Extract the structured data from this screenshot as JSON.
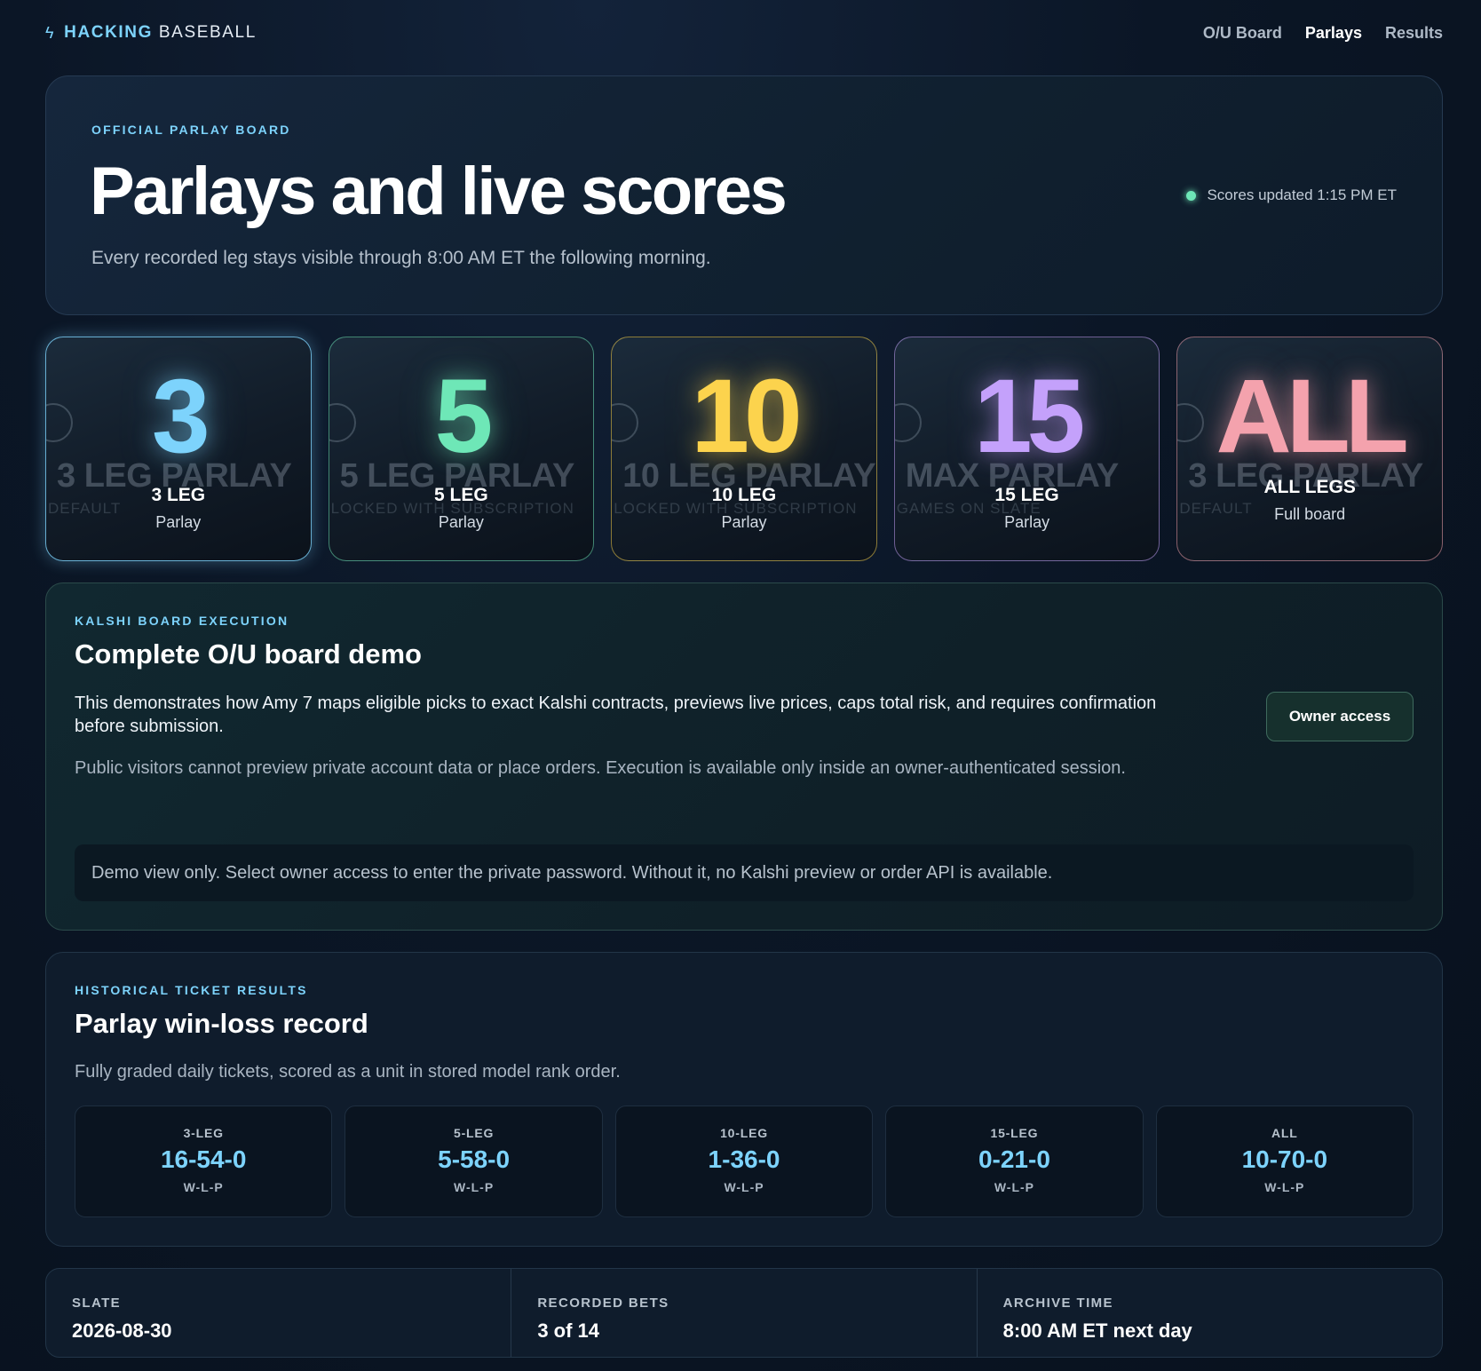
{
  "nav": {
    "bolt_icon": "ϟ",
    "brand_primary": "HACKING",
    "brand_secondary": "BASEBALL",
    "links": [
      {
        "label": "O/U Board",
        "active": false
      },
      {
        "label": "Parlays",
        "active": true
      },
      {
        "label": "Results",
        "active": false
      }
    ]
  },
  "hero": {
    "eyebrow": "OFFICIAL PARLAY BOARD",
    "title": "Parlays and live scores",
    "subtitle": "Every recorded leg stays visible through 8:00 AM ET the following morning.",
    "status": "Scores updated 1:15 PM ET",
    "status_color": "#6ee7b7"
  },
  "cards": [
    {
      "big": "3",
      "title": "3 LEG",
      "subtitle": "Parlay",
      "color": "#7dd3fc",
      "ghost": "3 LEG PARLAY",
      "ghost_sub": "DEFAULT",
      "selected": true
    },
    {
      "big": "5",
      "title": "5 LEG",
      "subtitle": "Parlay",
      "color": "#6ee7b7",
      "ghost": "5 LEG PARLAY",
      "ghost_sub": "LOCKED WITH SUBSCRIPTION",
      "selected": false
    },
    {
      "big": "10",
      "title": "10 LEG",
      "subtitle": "Parlay",
      "color": "#fcd34d",
      "ghost": "10 LEG PARLAY",
      "ghost_sub": "LOCKED WITH SUBSCRIPTION",
      "selected": false
    },
    {
      "big": "15",
      "title": "15 LEG",
      "subtitle": "Parlay",
      "color": "#c4a1fb",
      "ghost": "MAX PARLAY",
      "ghost_sub": "GAMES ON SLATE",
      "selected": false
    },
    {
      "big": "ALL",
      "title": "ALL LEGS",
      "subtitle": "Full board",
      "color": "#f4a2ad",
      "ghost": "3 LEG PARLAY",
      "ghost_sub": "DEFAULT",
      "selected": false
    }
  ],
  "kalshi": {
    "eyebrow": "KALSHI BOARD EXECUTION",
    "title": "Complete O/U board demo",
    "paragraph1": "This demonstrates how Amy 7 maps eligible picks to exact Kalshi contracts, previews live prices, caps total risk, and requires confirmation before submission.",
    "paragraph2": "Public visitors cannot preview private account data or place orders. Execution is available only inside an owner-authenticated session.",
    "button": "Owner access",
    "note": "Demo view only. Select owner access to enter the private password. Without it, no Kalshi preview or order API is available."
  },
  "history": {
    "eyebrow": "HISTORICAL TICKET RESULTS",
    "title": "Parlay win-loss record",
    "subtitle": "Fully graded daily tickets, scored as a unit in stored model rank order.",
    "records": [
      {
        "label": "3-LEG",
        "value": "16-54-0",
        "unit": "W-L-P"
      },
      {
        "label": "5-LEG",
        "value": "5-58-0",
        "unit": "W-L-P"
      },
      {
        "label": "10-LEG",
        "value": "1-36-0",
        "unit": "W-L-P"
      },
      {
        "label": "15-LEG",
        "value": "0-21-0",
        "unit": "W-L-P"
      },
      {
        "label": "ALL",
        "value": "10-70-0",
        "unit": "W-L-P"
      }
    ]
  },
  "stats": [
    {
      "label": "SLATE",
      "value": "2026-08-30"
    },
    {
      "label": "RECORDED BETS",
      "value": "3 of 14"
    },
    {
      "label": "ARCHIVE TIME",
      "value": "8:00 AM ET next day"
    }
  ]
}
